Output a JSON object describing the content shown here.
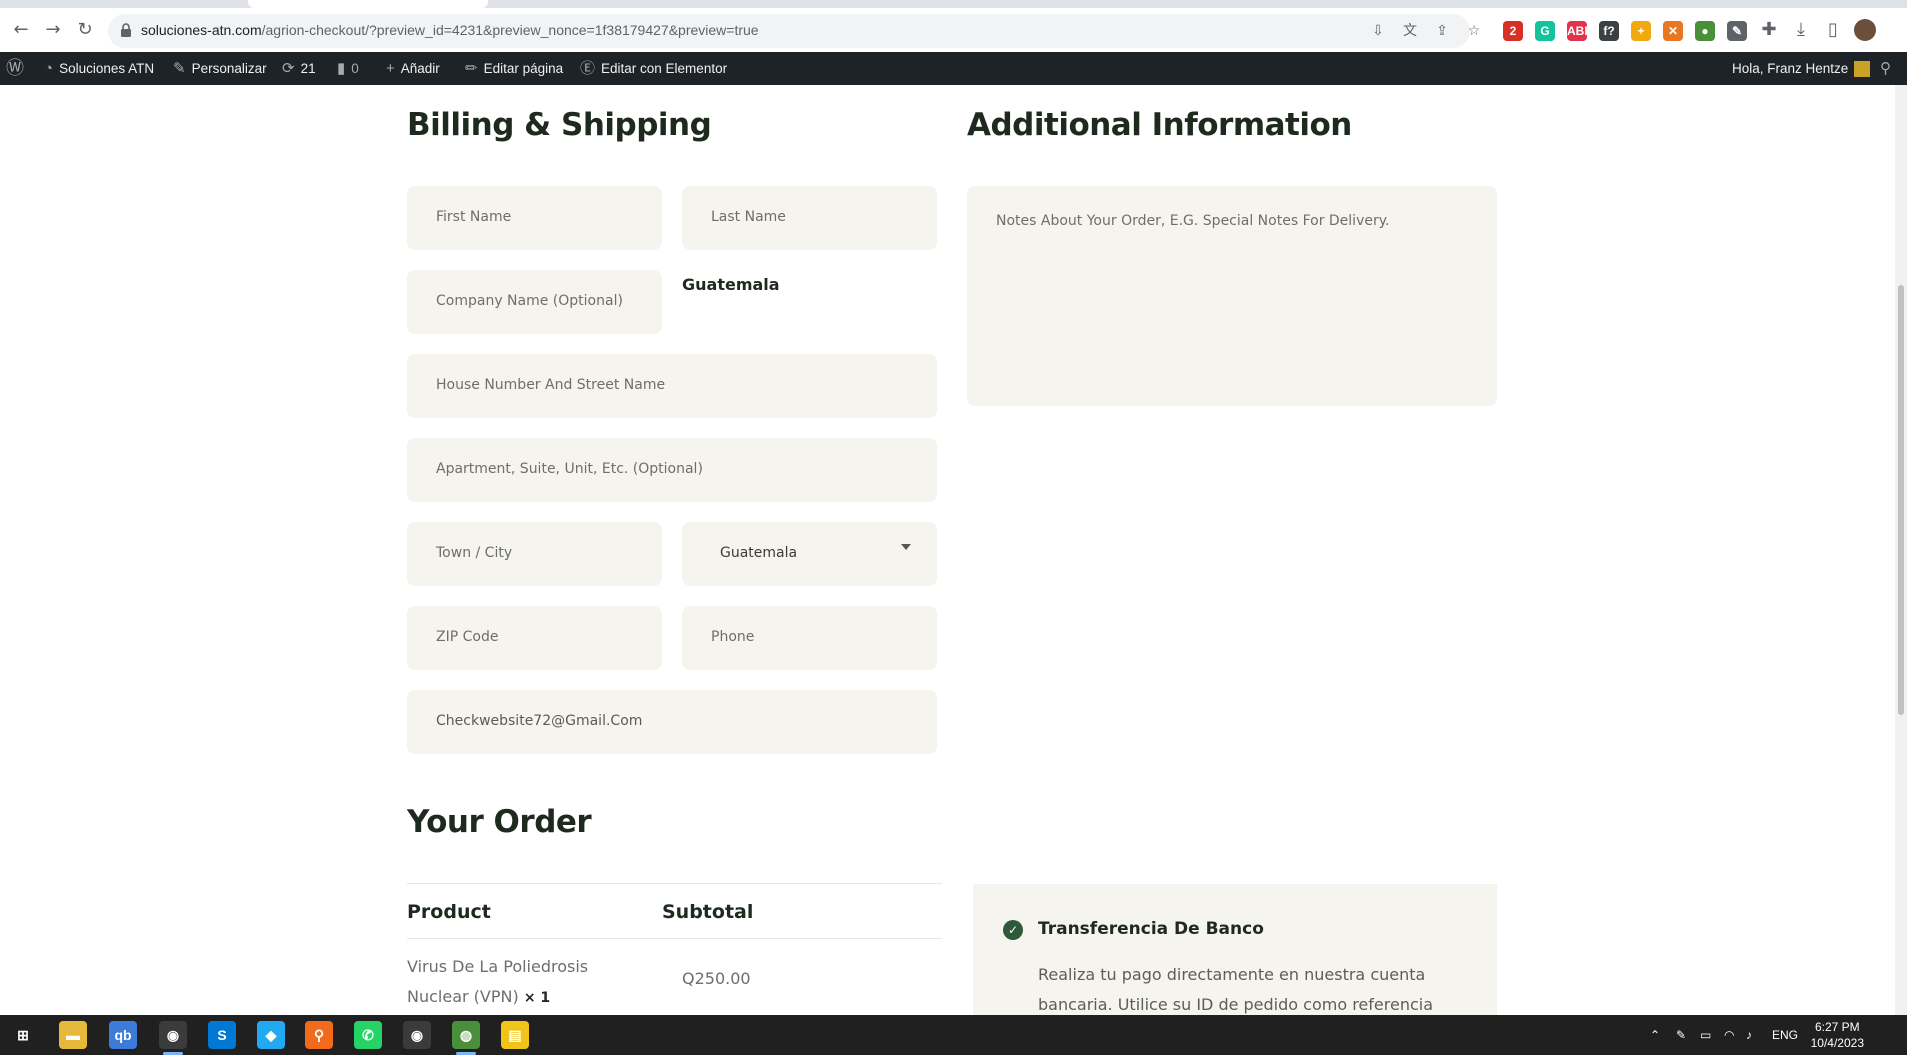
{
  "browser": {
    "url_host": "soluciones-atn.com",
    "url_rest": "/agrion-checkout/?preview_id=4231&preview_nonce=1f38179427&preview=true",
    "extensions": [
      {
        "name": "extension-badge-icon",
        "label": "2",
        "color": "#d93025"
      },
      {
        "name": "grammarly-icon",
        "label": "G",
        "color": "#15c39a"
      },
      {
        "name": "adblock-icon",
        "label": "ABP",
        "color": "#e3334b"
      },
      {
        "name": "font-icon",
        "label": "f?",
        "color": "#3c4043"
      },
      {
        "name": "extension-plus-icon",
        "label": "+",
        "color": "#f2a90f"
      },
      {
        "name": "tools-icon",
        "label": "✕",
        "color": "#e87722"
      },
      {
        "name": "globe-extension-icon",
        "label": "●",
        "color": "#4a8f3a"
      },
      {
        "name": "brush-icon",
        "label": "✎",
        "color": "#5f6368"
      }
    ]
  },
  "wp_admin_bar": {
    "site_name": "Soluciones ATN",
    "customize": "Personalizar",
    "updates_count": "21",
    "comments_count": "0",
    "add_new": "Añadir",
    "edit_page": "Editar página",
    "edit_elementor": "Editar con Elementor",
    "greeting": "Hola, Franz Hentze"
  },
  "billing": {
    "heading": "Billing & Shipping",
    "first_name_placeholder": "First Name",
    "last_name_placeholder": "Last Name",
    "company_placeholder": "Company Name (Optional)",
    "country_label": "Guatemala",
    "street_placeholder": "House Number And Street Name",
    "apartment_placeholder": "Apartment, Suite, Unit, Etc. (Optional)",
    "city_placeholder": "Town / City",
    "state_value": "Guatemala",
    "zip_placeholder": "ZIP Code",
    "phone_placeholder": "Phone",
    "email_value": "Checkwebsite72@Gmail.Com"
  },
  "additional": {
    "heading": "Additional Information",
    "notes_placeholder": "Notes About Your Order, E.G. Special Notes For Delivery."
  },
  "order": {
    "heading": "Your Order",
    "col_product": "Product",
    "col_subtotal": "Subtotal",
    "item_name": "Virus De La Poliedrosis Nuclear (VPN)",
    "item_qty": "× 1",
    "item_price": "Q250.00"
  },
  "payment": {
    "method_title": "Transferencia De Banco",
    "method_desc": "Realiza tu pago directamente en nuestra cuenta bancaria. Utilice su ID de pedido como referencia de"
  },
  "taskbar": {
    "apps": [
      {
        "name": "start-icon",
        "label": "⊞",
        "color": "#202020"
      },
      {
        "name": "file-explorer-icon",
        "label": "▬",
        "color": "#e8b83a"
      },
      {
        "name": "qbittorrent-icon",
        "label": "qb",
        "color": "#3d7bd9"
      },
      {
        "name": "chrome-icon",
        "label": "◉",
        "color": "#3b3b3b"
      },
      {
        "name": "skype-icon",
        "label": "S",
        "color": "#0078d4"
      },
      {
        "name": "vscode-icon",
        "label": "◆",
        "color": "#23a9f2"
      },
      {
        "name": "search-app-icon",
        "label": "⚲",
        "color": "#f26b1d"
      },
      {
        "name": "whatsapp-icon",
        "label": "✆",
        "color": "#25d366"
      },
      {
        "name": "chrome-profile-icon",
        "label": "◉",
        "color": "#3b3b3b"
      },
      {
        "name": "globe-app-icon",
        "label": "◍",
        "color": "#4a8f3a"
      },
      {
        "name": "files-app-icon",
        "label": "▤",
        "color": "#f0c419"
      }
    ],
    "language": "ENG",
    "time": "6:27 PM",
    "date": "10/4/2023"
  }
}
